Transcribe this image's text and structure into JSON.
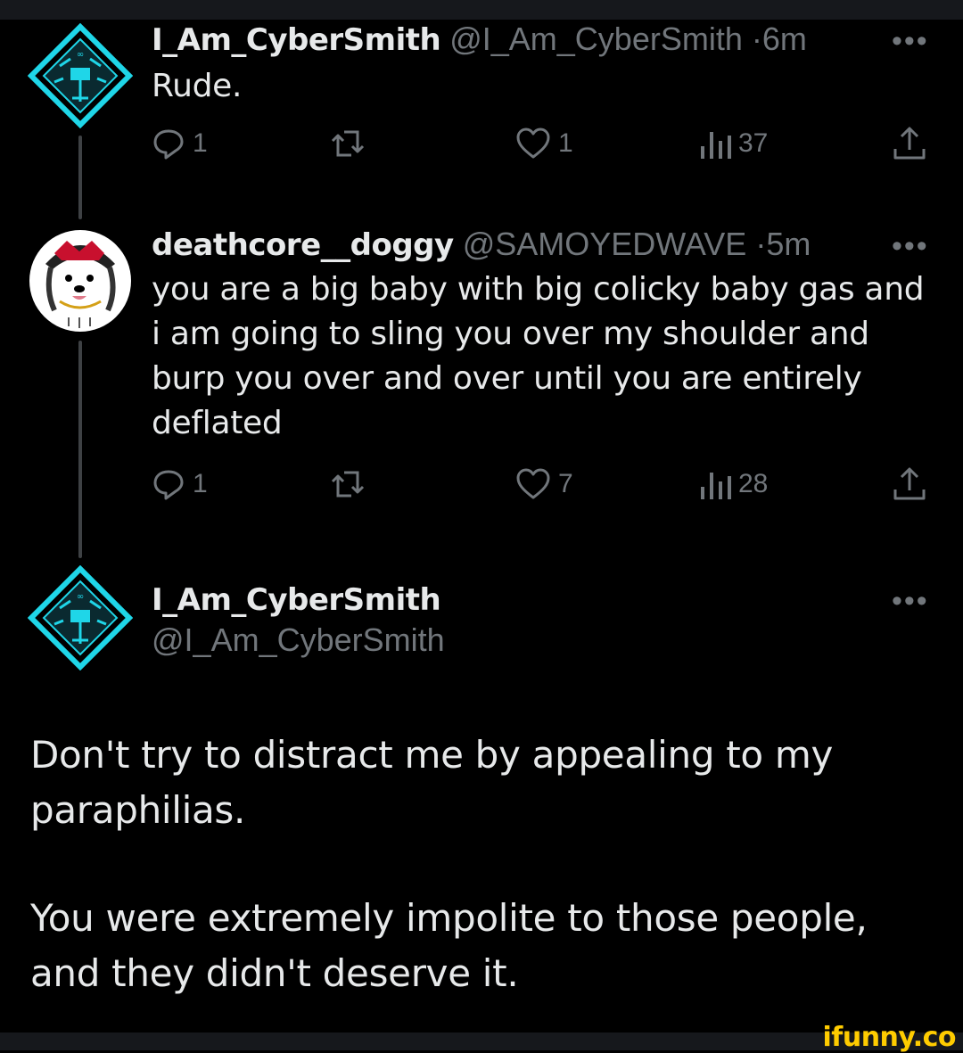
{
  "tweets": [
    {
      "name": "I_Am_CyberSmith",
      "handle": "@I_Am_CyberSmith",
      "separator": "·",
      "time": "6m",
      "text": "Rude.",
      "replies": "1",
      "retweets": "",
      "likes": "1",
      "views": "37"
    },
    {
      "name": "deathcore__doggy",
      "handle": "@SAMOYEDWAVE",
      "separator": "·",
      "time": "5m",
      "text": "you are a big baby with big colicky baby gas and i am going to sling you over my shoulder and burp you over and over until you are entirely deflated",
      "replies": "1",
      "retweets": "",
      "likes": "7",
      "views": "28"
    }
  ],
  "main_tweet": {
    "name": "I_Am_CyberSmith",
    "handle": "@I_Am_CyberSmith",
    "paragraph1": "Don't try to distract me by appealing to my paraphilias.",
    "paragraph2": "You were extremely impolite to those people, and they didn't deserve it."
  },
  "more_label": "•••",
  "watermark": "ifunny.co",
  "icons": {
    "reply": "reply-icon",
    "retweet": "retweet-icon",
    "like": "heart-icon",
    "views": "views-icon",
    "share": "share-icon",
    "more": "more-icon"
  },
  "colors": {
    "background": "#000000",
    "text": "#e7e9ea",
    "muted": "#71767b",
    "avatar_cyan": "#1fd6e8",
    "watermark": "#ffcc00"
  }
}
